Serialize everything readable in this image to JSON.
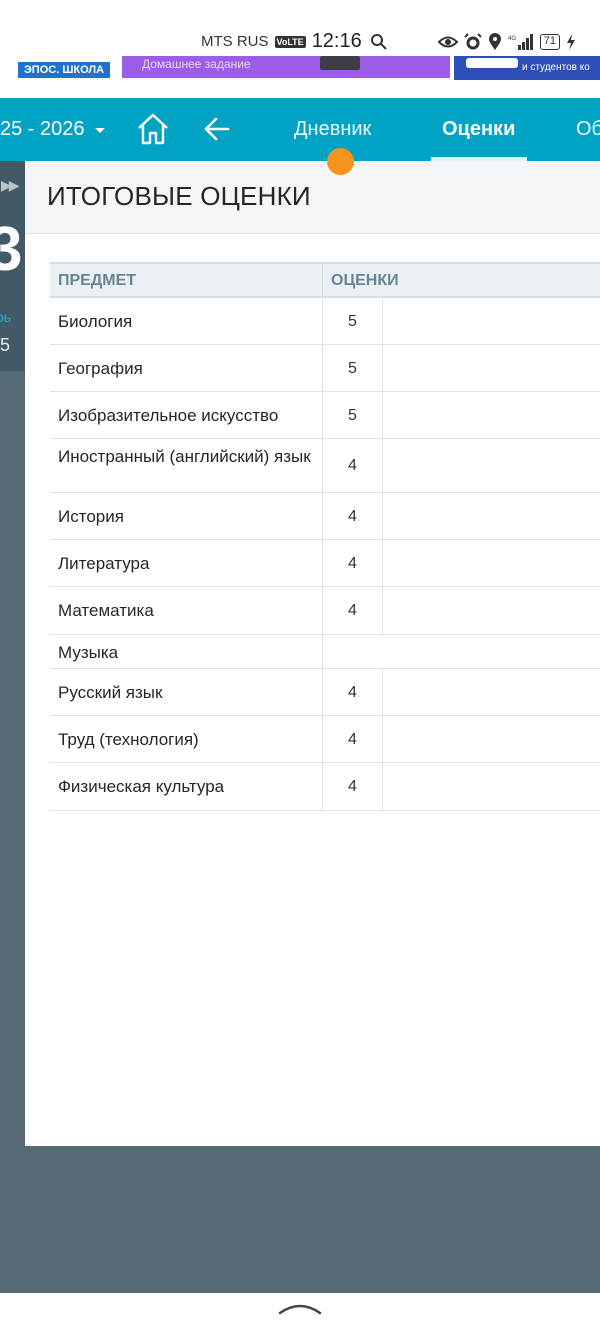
{
  "status_bar": {
    "carrier": "MTS RUS",
    "volte": "VoLTE",
    "time": "12:16",
    "battery": "71"
  },
  "banner": {
    "school_label": "ЭПОС. ШКОЛА",
    "homework_label": "Домашнее задание",
    "students_label": "и студентов ко"
  },
  "nav": {
    "year": "25 - 2026",
    "tabs": [
      {
        "label": "Дневник",
        "active": false
      },
      {
        "label": "Оценки",
        "active": true
      },
      {
        "label": "Об",
        "active": false
      }
    ],
    "accent_color": "#00a3c4",
    "badge_color": "#f7941d"
  },
  "side_panel": {
    "big_number": "3",
    "small_label": "рь",
    "small_number": "5"
  },
  "page": {
    "title": "ИТОГОВЫЕ ОЦЕНКИ"
  },
  "table": {
    "headers": {
      "subject": "ПРЕДМЕТ",
      "grades": "ОЦЕНКИ"
    },
    "rows": [
      {
        "subject": "Биология",
        "grade": "5"
      },
      {
        "subject": "География",
        "grade": "5"
      },
      {
        "subject": "Изобразительное искусство",
        "grade": "5"
      },
      {
        "subject": "Иностранный (английский) язык",
        "grade": "4"
      },
      {
        "subject": "История",
        "grade": "4"
      },
      {
        "subject": "Литература",
        "grade": "4"
      },
      {
        "subject": "Математика",
        "grade": "4"
      },
      {
        "subject": "Музыка",
        "grade": ""
      },
      {
        "subject": "Русский язык",
        "grade": "4"
      },
      {
        "subject": "Труд (технология)",
        "grade": "4"
      },
      {
        "subject": "Физическая культура",
        "grade": "4"
      }
    ]
  }
}
